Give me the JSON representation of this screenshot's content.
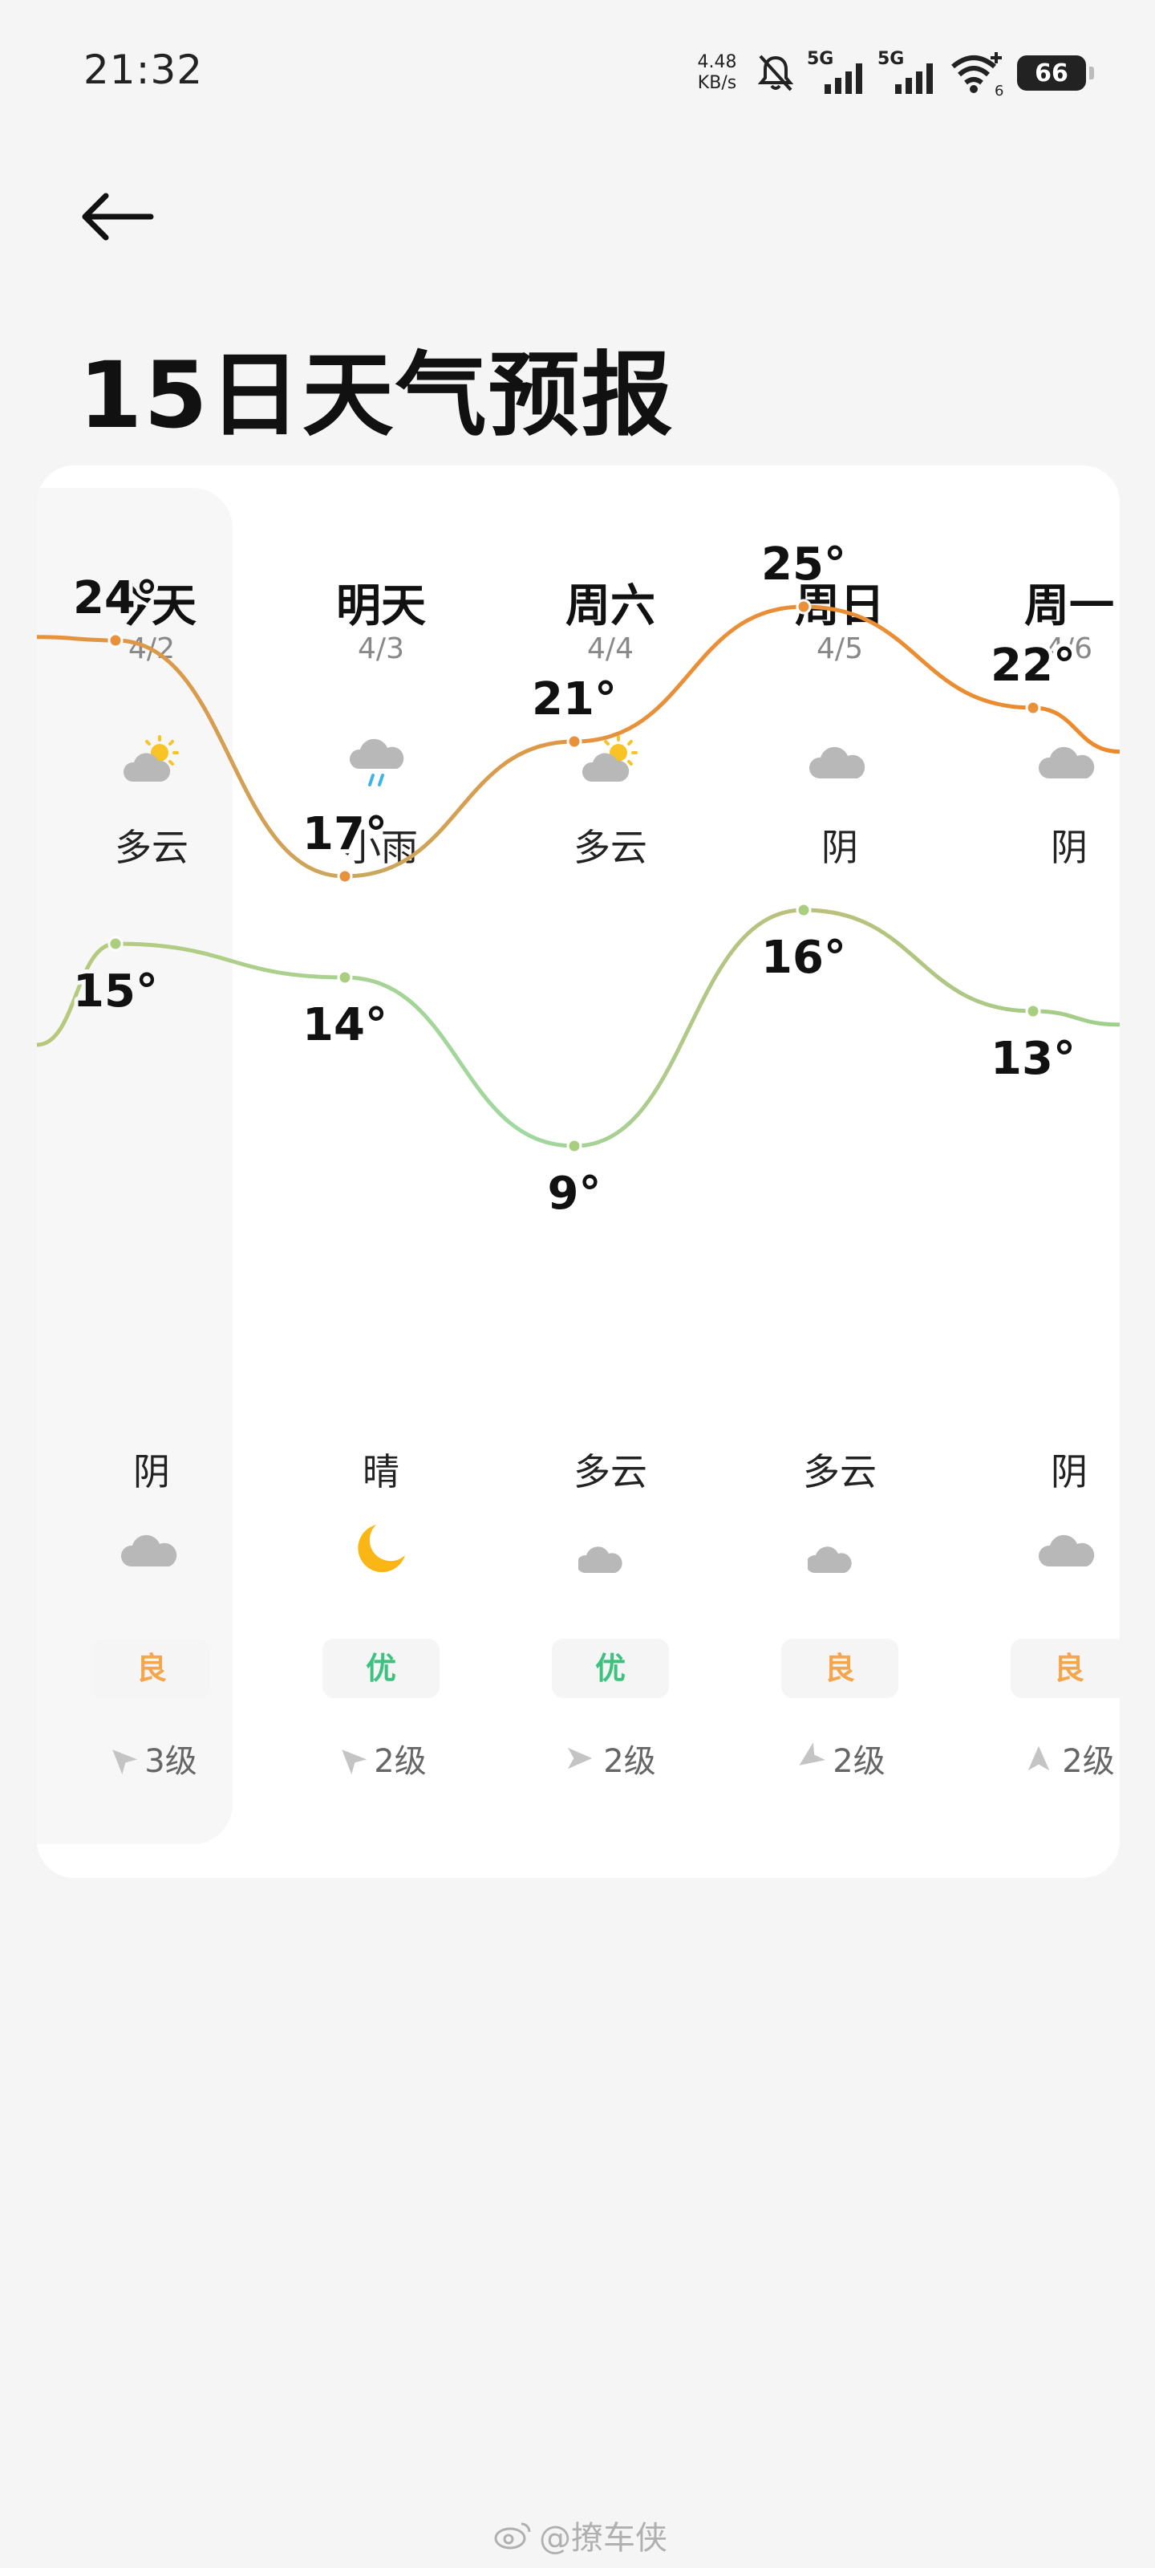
{
  "status_bar": {
    "time": "21:32",
    "net_speed_value": "4.48",
    "net_speed_unit": "KB/s",
    "sim1_label": "5G",
    "sim2_label": "5G",
    "wifi_sub": "6",
    "battery": "66"
  },
  "header": {
    "title": "15日天气预报"
  },
  "days": [
    {
      "name": "今天",
      "date": "4/2",
      "day_icon": "partly-cloudy-day-icon",
      "day_weather": "多云",
      "high": "24°",
      "low": "15°",
      "night_weather": "阴",
      "night_icon": "cloudy-icon",
      "aqi": "良",
      "aqi_color": "#f5a54a",
      "wind": "3级",
      "wind_dir": "northwest"
    },
    {
      "name": "明天",
      "date": "4/3",
      "day_icon": "light-rain-icon",
      "day_weather": "小雨",
      "high": "17°",
      "low": "14°",
      "night_weather": "晴",
      "night_icon": "moon-icon",
      "aqi": "优",
      "aqi_color": "#3cc27e",
      "wind": "2级",
      "wind_dir": "northwest"
    },
    {
      "name": "周六",
      "date": "4/4",
      "day_icon": "partly-cloudy-day-icon",
      "day_weather": "多云",
      "high": "21°",
      "low": "9°",
      "night_weather": "多云",
      "night_icon": "partly-cloudy-night-icon",
      "aqi": "优",
      "aqi_color": "#3cc27e",
      "wind": "2级",
      "wind_dir": "west"
    },
    {
      "name": "周日",
      "date": "4/5",
      "day_icon": "cloudy-icon",
      "day_weather": "阴",
      "high": "25°",
      "low": "16°",
      "night_weather": "多云",
      "night_icon": "partly-cloudy-night-icon",
      "aqi": "良",
      "aqi_color": "#f5a54a",
      "wind": "2级",
      "wind_dir": "northeast"
    },
    {
      "name": "周一",
      "date": "4/6",
      "day_icon": "cloudy-icon",
      "day_weather": "阴",
      "high": "22°",
      "low": "13°",
      "night_weather": "阴",
      "night_icon": "cloudy-icon",
      "aqi": "良",
      "aqi_color": "#f5a54a",
      "wind": "2级",
      "wind_dir": "south"
    }
  ],
  "chart_data": {
    "type": "line",
    "categories": [
      "今天",
      "明天",
      "周六",
      "周日",
      "周一"
    ],
    "series": [
      {
        "values": [
          24,
          17,
          21,
          25,
          22
        ],
        "color": "#ec8a2c"
      },
      {
        "values": [
          15,
          14,
          9,
          16,
          13
        ],
        "color": "#9fd08d"
      }
    ],
    "ylim": [
      6,
      27
    ]
  },
  "watermark": {
    "text": "@撩车侠"
  }
}
